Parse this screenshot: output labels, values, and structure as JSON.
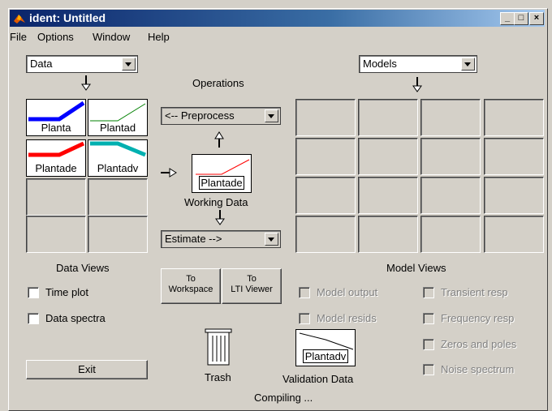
{
  "window": {
    "title": "ident: Untitled",
    "min_glyph": "_",
    "max_glyph": "□",
    "close_glyph": "×"
  },
  "menu": {
    "file": "File",
    "options": "Options",
    "window": "Window",
    "help": "Help"
  },
  "data_popup": "Data",
  "models_popup": "Models",
  "operations": {
    "title": "Operations",
    "preprocess": "<-- Preprocess",
    "estimate": "Estimate -->",
    "working_data_label": "Working Data",
    "working_data_icon": "Plantade"
  },
  "data_icons": [
    {
      "label": "Planta",
      "color": "#0000ff"
    },
    {
      "label": "Plantad",
      "color": "#008000"
    },
    {
      "label": "Plantade",
      "color": "#ff0000"
    },
    {
      "label": "Plantadv",
      "color": "#00b0b0"
    }
  ],
  "data_views": {
    "title": "Data Views",
    "time_plot": "Time plot",
    "data_spectra": "Data spectra"
  },
  "buttons": {
    "to_workspace_1": "To",
    "to_workspace_2": "Workspace",
    "to_lti_1": "To",
    "to_lti_2": "LTI Viewer",
    "exit": "Exit"
  },
  "trash_label": "Trash",
  "validation": {
    "label": "Validation Data",
    "icon": "Plantadv"
  },
  "model_views": {
    "title": "Model Views",
    "model_output": "Model output",
    "model_resids": "Model resids",
    "transient_resp": "Transient resp",
    "frequency_resp": "Frequency resp",
    "zeros_poles": "Zeros and poles",
    "noise_spectrum": "Noise spectrum"
  },
  "status": "Compiling ..."
}
